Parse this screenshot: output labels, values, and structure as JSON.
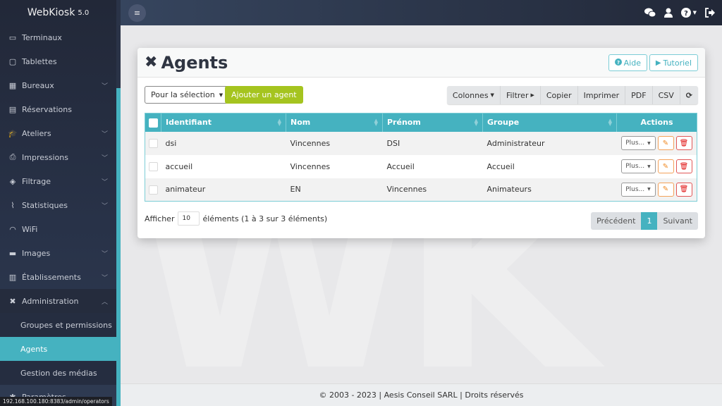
{
  "brand": {
    "name": "WebKiosk",
    "version": "5.0"
  },
  "sidebar": {
    "items": [
      {
        "label": "Terminaux",
        "icon": "laptop-icon",
        "glyph": "▭",
        "chevron": false
      },
      {
        "label": "Tablettes",
        "icon": "tablet-icon",
        "glyph": "▢",
        "chevron": false
      },
      {
        "label": "Bureaux",
        "icon": "table-icon",
        "glyph": "▦",
        "chevron": true
      },
      {
        "label": "Réservations",
        "icon": "calendar-icon",
        "glyph": "▤",
        "chevron": false
      },
      {
        "label": "Ateliers",
        "icon": "graduation-cap-icon",
        "glyph": "🎓",
        "chevron": true
      },
      {
        "label": "Impressions",
        "icon": "printer-icon",
        "glyph": "⎙",
        "chevron": true
      },
      {
        "label": "Filtrage",
        "icon": "shield-icon",
        "glyph": "◈",
        "chevron": true
      },
      {
        "label": "Statistiques",
        "icon": "line-chart-icon",
        "glyph": "⌇",
        "chevron": true
      },
      {
        "label": "WiFi",
        "icon": "wifi-icon",
        "glyph": "◠",
        "chevron": false
      },
      {
        "label": "Images",
        "icon": "server-icon",
        "glyph": "▬",
        "chevron": true
      },
      {
        "label": "Établissements",
        "icon": "building-icon",
        "glyph": "▥",
        "chevron": true
      },
      {
        "label": "Administration",
        "icon": "tools-icon",
        "glyph": "✖",
        "chevron": true,
        "open": true
      }
    ],
    "sub_items": [
      {
        "label": "Groupes et permissions",
        "active": false
      },
      {
        "label": "Agents",
        "active": true
      },
      {
        "label": "Gestion des médias",
        "active": false
      }
    ],
    "last_item": {
      "label": "Paramètres",
      "icon": "gear-icon",
      "glyph": "✱"
    }
  },
  "status_url": "192.168.100.180:8383/admin/operators",
  "topbar": {
    "menu_glyph": "≡",
    "icons": [
      "chat-icon",
      "user-icon",
      "help-icon",
      "logout-icon"
    ]
  },
  "page": {
    "title": "Agents",
    "help_label": "Aide",
    "tutorial_label": "Tutoriel",
    "selection_label": "Pour la sélection",
    "add_label": "Ajouter un agent",
    "tools": [
      "Colonnes",
      "Filtrer",
      "Copier",
      "Imprimer",
      "PDF",
      "CSV"
    ]
  },
  "table": {
    "headers": [
      "Identifiant",
      "Nom",
      "Prénom",
      "Groupe",
      "Actions"
    ],
    "rows": [
      {
        "identifiant": "dsi",
        "nom": "Vincennes",
        "prenom": "DSI",
        "groupe": "Administrateur"
      },
      {
        "identifiant": "accueil",
        "nom": "Vincennes",
        "prenom": "Accueil",
        "groupe": "Accueil"
      },
      {
        "identifiant": "animateur",
        "nom": "EN",
        "prenom": "Vincennes",
        "groupe": "Animateurs"
      }
    ],
    "more_label": "Plus..."
  },
  "length": {
    "prefix": "Afficher",
    "value": "10",
    "suffix": "éléments (1 à 3 sur 3 éléments)"
  },
  "pager": {
    "prev": "Précédent",
    "current": "1",
    "next": "Suivant"
  },
  "footer": "© 2003 - 2023 | Aesis Conseil SARL | Droits réservés",
  "colors": {
    "accent": "#45b2c0",
    "add": "#a5c41f",
    "edit": "#f08a24",
    "delete": "#e01414"
  }
}
